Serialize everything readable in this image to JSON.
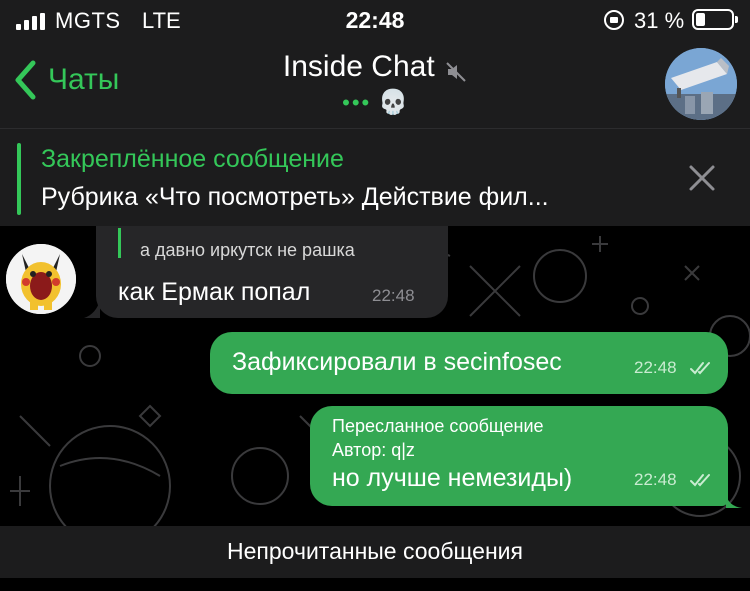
{
  "status_bar": {
    "carrier": "MGTS",
    "network": "LTE",
    "time": "22:48",
    "battery_percent": "31 %"
  },
  "header": {
    "back_label": "Чаты",
    "title": "Inside Chat",
    "typing_dots": "•••",
    "status_emoji": "💀"
  },
  "pinned": {
    "title": "Закреплённое сообщение",
    "text": "Рубрика «Что посмотреть» Действие фил..."
  },
  "messages": {
    "incoming": {
      "reply_text": "а давно иркутск не рашка",
      "text": "как Ермак попал",
      "time": "22:48"
    },
    "outgoing_1": {
      "text": "Зафиксировали в secinfosec",
      "time": "22:48"
    },
    "outgoing_2": {
      "forward_label": "Пересланное сообщение",
      "author": "Автор: q|z",
      "text": "но лучше немезиды)",
      "time": "22:48"
    }
  },
  "unread_bar": {
    "label": "Непрочитанные сообщения"
  },
  "colors": {
    "accent": "#34c759",
    "bubble_out": "#34a853",
    "bubble_in": "#262628",
    "bar_bg": "#1c1c1d"
  }
}
